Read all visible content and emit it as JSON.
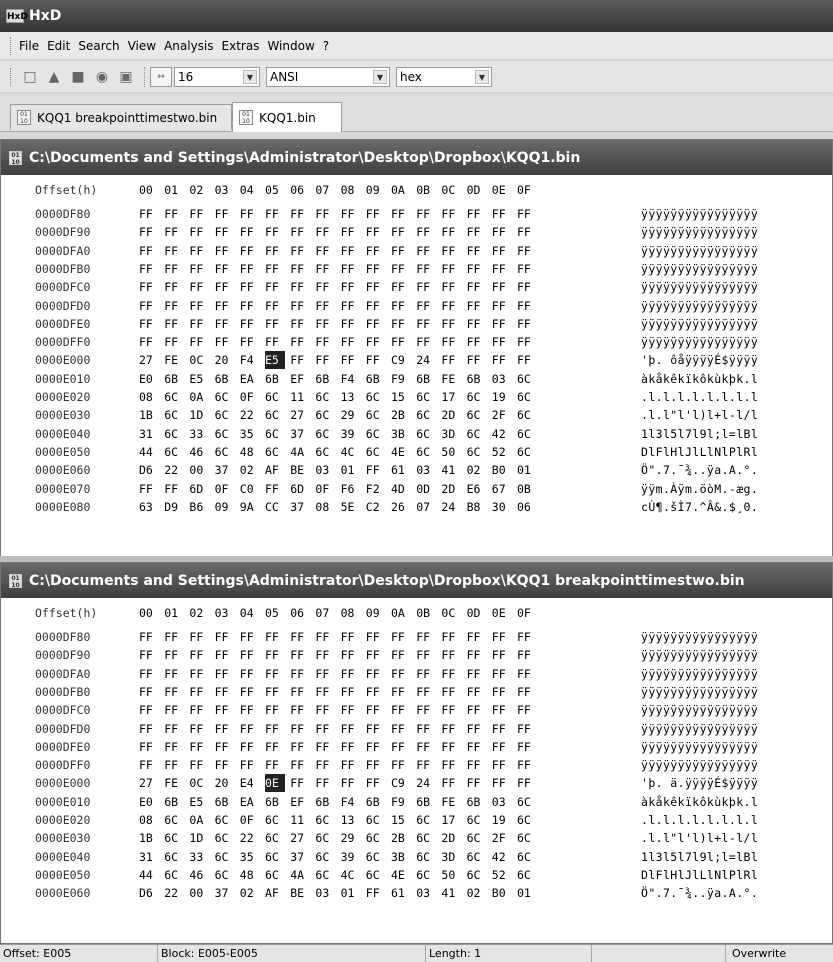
{
  "window": {
    "title": "HxD"
  },
  "menu": [
    "File",
    "Edit",
    "Search",
    "View",
    "Analysis",
    "Extras",
    "Window",
    "?"
  ],
  "toolbar": {
    "bytes_per_row": "16",
    "charset": "ANSI",
    "display_mode": "hex"
  },
  "tabs": [
    {
      "label": "KQQ1 breakpointtimestwo.bin",
      "active": false
    },
    {
      "label": "KQQ1.bin",
      "active": true
    }
  ],
  "editors": [
    {
      "path": "C:\\Documents and Settings\\Administrator\\Desktop\\Dropbox\\KQQ1.bin",
      "selected_col": 5,
      "selected_row": 8,
      "rows": [
        {
          "offset": "0000DF80",
          "bytes": [
            "FF",
            "FF",
            "FF",
            "FF",
            "FF",
            "FF",
            "FF",
            "FF",
            "FF",
            "FF",
            "FF",
            "FF",
            "FF",
            "FF",
            "FF",
            "FF"
          ],
          "ascii": "ÿÿÿÿÿÿÿÿÿÿÿÿÿÿÿÿ"
        },
        {
          "offset": "0000DF90",
          "bytes": [
            "FF",
            "FF",
            "FF",
            "FF",
            "FF",
            "FF",
            "FF",
            "FF",
            "FF",
            "FF",
            "FF",
            "FF",
            "FF",
            "FF",
            "FF",
            "FF"
          ],
          "ascii": "ÿÿÿÿÿÿÿÿÿÿÿÿÿÿÿÿ"
        },
        {
          "offset": "0000DFA0",
          "bytes": [
            "FF",
            "FF",
            "FF",
            "FF",
            "FF",
            "FF",
            "FF",
            "FF",
            "FF",
            "FF",
            "FF",
            "FF",
            "FF",
            "FF",
            "FF",
            "FF"
          ],
          "ascii": "ÿÿÿÿÿÿÿÿÿÿÿÿÿÿÿÿ"
        },
        {
          "offset": "0000DFB0",
          "bytes": [
            "FF",
            "FF",
            "FF",
            "FF",
            "FF",
            "FF",
            "FF",
            "FF",
            "FF",
            "FF",
            "FF",
            "FF",
            "FF",
            "FF",
            "FF",
            "FF"
          ],
          "ascii": "ÿÿÿÿÿÿÿÿÿÿÿÿÿÿÿÿ"
        },
        {
          "offset": "0000DFC0",
          "bytes": [
            "FF",
            "FF",
            "FF",
            "FF",
            "FF",
            "FF",
            "FF",
            "FF",
            "FF",
            "FF",
            "FF",
            "FF",
            "FF",
            "FF",
            "FF",
            "FF"
          ],
          "ascii": "ÿÿÿÿÿÿÿÿÿÿÿÿÿÿÿÿ"
        },
        {
          "offset": "0000DFD0",
          "bytes": [
            "FF",
            "FF",
            "FF",
            "FF",
            "FF",
            "FF",
            "FF",
            "FF",
            "FF",
            "FF",
            "FF",
            "FF",
            "FF",
            "FF",
            "FF",
            "FF"
          ],
          "ascii": "ÿÿÿÿÿÿÿÿÿÿÿÿÿÿÿÿ"
        },
        {
          "offset": "0000DFE0",
          "bytes": [
            "FF",
            "FF",
            "FF",
            "FF",
            "FF",
            "FF",
            "FF",
            "FF",
            "FF",
            "FF",
            "FF",
            "FF",
            "FF",
            "FF",
            "FF",
            "FF"
          ],
          "ascii": "ÿÿÿÿÿÿÿÿÿÿÿÿÿÿÿÿ"
        },
        {
          "offset": "0000DFF0",
          "bytes": [
            "FF",
            "FF",
            "FF",
            "FF",
            "FF",
            "FF",
            "FF",
            "FF",
            "FF",
            "FF",
            "FF",
            "FF",
            "FF",
            "FF",
            "FF",
            "FF"
          ],
          "ascii": "ÿÿÿÿÿÿÿÿÿÿÿÿÿÿÿÿ"
        },
        {
          "offset": "0000E000",
          "bytes": [
            "27",
            "FE",
            "0C",
            "20",
            "F4",
            "E5",
            "FF",
            "FF",
            "FF",
            "FF",
            "C9",
            "24",
            "FF",
            "FF",
            "FF",
            "FF"
          ],
          "ascii": "'þ. ôåÿÿÿÿÉ$ÿÿÿÿ"
        },
        {
          "offset": "0000E010",
          "bytes": [
            "E0",
            "6B",
            "E5",
            "6B",
            "EA",
            "6B",
            "EF",
            "6B",
            "F4",
            "6B",
            "F9",
            "6B",
            "FE",
            "6B",
            "03",
            "6C"
          ],
          "ascii": "àkåkêkïkôkùkþk.l"
        },
        {
          "offset": "0000E020",
          "bytes": [
            "08",
            "6C",
            "0A",
            "6C",
            "0F",
            "6C",
            "11",
            "6C",
            "13",
            "6C",
            "15",
            "6C",
            "17",
            "6C",
            "19",
            "6C"
          ],
          "ascii": ".l.l.l.l.l.l.l.l"
        },
        {
          "offset": "0000E030",
          "bytes": [
            "1B",
            "6C",
            "1D",
            "6C",
            "22",
            "6C",
            "27",
            "6C",
            "29",
            "6C",
            "2B",
            "6C",
            "2D",
            "6C",
            "2F",
            "6C"
          ],
          "ascii": ".l.l\"l'l)l+l-l/l"
        },
        {
          "offset": "0000E040",
          "bytes": [
            "31",
            "6C",
            "33",
            "6C",
            "35",
            "6C",
            "37",
            "6C",
            "39",
            "6C",
            "3B",
            "6C",
            "3D",
            "6C",
            "42",
            "6C"
          ],
          "ascii": "1l3l5l7l9l;l=lBl"
        },
        {
          "offset": "0000E050",
          "bytes": [
            "44",
            "6C",
            "46",
            "6C",
            "48",
            "6C",
            "4A",
            "6C",
            "4C",
            "6C",
            "4E",
            "6C",
            "50",
            "6C",
            "52",
            "6C"
          ],
          "ascii": "DlFlHlJlLlNlPlRl"
        },
        {
          "offset": "0000E060",
          "bytes": [
            "D6",
            "22",
            "00",
            "37",
            "02",
            "AF",
            "BE",
            "03",
            "01",
            "FF",
            "61",
            "03",
            "41",
            "02",
            "B0",
            "01"
          ],
          "ascii": "Ö\".7.¯¾..ÿa.A.°."
        },
        {
          "offset": "0000E070",
          "bytes": [
            "FF",
            "FF",
            "6D",
            "0F",
            "C0",
            "FF",
            "6D",
            "0F",
            "F6",
            "F2",
            "4D",
            "0D",
            "2D",
            "E6",
            "67",
            "0B"
          ],
          "ascii": "ÿÿm.Àÿm.öòM.-æg."
        },
        {
          "offset": "0000E080",
          "bytes": [
            "63",
            "D9",
            "B6",
            "09",
            "9A",
            "CC",
            "37",
            "08",
            "5E",
            "C2",
            "26",
            "07",
            "24",
            "B8",
            "30",
            "06"
          ],
          "ascii": "cÙ¶.šÌ7.^Â&.$¸0."
        }
      ]
    },
    {
      "path": "C:\\Documents and Settings\\Administrator\\Desktop\\Dropbox\\KQQ1 breakpointtimestwo.bin",
      "selected_col": 5,
      "selected_row": 8,
      "rows": [
        {
          "offset": "0000DF80",
          "bytes": [
            "FF",
            "FF",
            "FF",
            "FF",
            "FF",
            "FF",
            "FF",
            "FF",
            "FF",
            "FF",
            "FF",
            "FF",
            "FF",
            "FF",
            "FF",
            "FF"
          ],
          "ascii": "ÿÿÿÿÿÿÿÿÿÿÿÿÿÿÿÿ"
        },
        {
          "offset": "0000DF90",
          "bytes": [
            "FF",
            "FF",
            "FF",
            "FF",
            "FF",
            "FF",
            "FF",
            "FF",
            "FF",
            "FF",
            "FF",
            "FF",
            "FF",
            "FF",
            "FF",
            "FF"
          ],
          "ascii": "ÿÿÿÿÿÿÿÿÿÿÿÿÿÿÿÿ"
        },
        {
          "offset": "0000DFA0",
          "bytes": [
            "FF",
            "FF",
            "FF",
            "FF",
            "FF",
            "FF",
            "FF",
            "FF",
            "FF",
            "FF",
            "FF",
            "FF",
            "FF",
            "FF",
            "FF",
            "FF"
          ],
          "ascii": "ÿÿÿÿÿÿÿÿÿÿÿÿÿÿÿÿ"
        },
        {
          "offset": "0000DFB0",
          "bytes": [
            "FF",
            "FF",
            "FF",
            "FF",
            "FF",
            "FF",
            "FF",
            "FF",
            "FF",
            "FF",
            "FF",
            "FF",
            "FF",
            "FF",
            "FF",
            "FF"
          ],
          "ascii": "ÿÿÿÿÿÿÿÿÿÿÿÿÿÿÿÿ"
        },
        {
          "offset": "0000DFC0",
          "bytes": [
            "FF",
            "FF",
            "FF",
            "FF",
            "FF",
            "FF",
            "FF",
            "FF",
            "FF",
            "FF",
            "FF",
            "FF",
            "FF",
            "FF",
            "FF",
            "FF"
          ],
          "ascii": "ÿÿÿÿÿÿÿÿÿÿÿÿÿÿÿÿ"
        },
        {
          "offset": "0000DFD0",
          "bytes": [
            "FF",
            "FF",
            "FF",
            "FF",
            "FF",
            "FF",
            "FF",
            "FF",
            "FF",
            "FF",
            "FF",
            "FF",
            "FF",
            "FF",
            "FF",
            "FF"
          ],
          "ascii": "ÿÿÿÿÿÿÿÿÿÿÿÿÿÿÿÿ"
        },
        {
          "offset": "0000DFE0",
          "bytes": [
            "FF",
            "FF",
            "FF",
            "FF",
            "FF",
            "FF",
            "FF",
            "FF",
            "FF",
            "FF",
            "FF",
            "FF",
            "FF",
            "FF",
            "FF",
            "FF"
          ],
          "ascii": "ÿÿÿÿÿÿÿÿÿÿÿÿÿÿÿÿ"
        },
        {
          "offset": "0000DFF0",
          "bytes": [
            "FF",
            "FF",
            "FF",
            "FF",
            "FF",
            "FF",
            "FF",
            "FF",
            "FF",
            "FF",
            "FF",
            "FF",
            "FF",
            "FF",
            "FF",
            "FF"
          ],
          "ascii": "ÿÿÿÿÿÿÿÿÿÿÿÿÿÿÿÿ"
        },
        {
          "offset": "0000E000",
          "bytes": [
            "27",
            "FE",
            "0C",
            "20",
            "E4",
            "0E",
            "FF",
            "FF",
            "FF",
            "FF",
            "C9",
            "24",
            "FF",
            "FF",
            "FF",
            "FF"
          ],
          "ascii": "'þ. ä.ÿÿÿÿÉ$ÿÿÿÿ"
        },
        {
          "offset": "0000E010",
          "bytes": [
            "E0",
            "6B",
            "E5",
            "6B",
            "EA",
            "6B",
            "EF",
            "6B",
            "F4",
            "6B",
            "F9",
            "6B",
            "FE",
            "6B",
            "03",
            "6C"
          ],
          "ascii": "àkåkêkïkôkùkþk.l"
        },
        {
          "offset": "0000E020",
          "bytes": [
            "08",
            "6C",
            "0A",
            "6C",
            "0F",
            "6C",
            "11",
            "6C",
            "13",
            "6C",
            "15",
            "6C",
            "17",
            "6C",
            "19",
            "6C"
          ],
          "ascii": ".l.l.l.l.l.l.l.l"
        },
        {
          "offset": "0000E030",
          "bytes": [
            "1B",
            "6C",
            "1D",
            "6C",
            "22",
            "6C",
            "27",
            "6C",
            "29",
            "6C",
            "2B",
            "6C",
            "2D",
            "6C",
            "2F",
            "6C"
          ],
          "ascii": ".l.l\"l'l)l+l-l/l"
        },
        {
          "offset": "0000E040",
          "bytes": [
            "31",
            "6C",
            "33",
            "6C",
            "35",
            "6C",
            "37",
            "6C",
            "39",
            "6C",
            "3B",
            "6C",
            "3D",
            "6C",
            "42",
            "6C"
          ],
          "ascii": "1l3l5l7l9l;l=lBl"
        },
        {
          "offset": "0000E050",
          "bytes": [
            "44",
            "6C",
            "46",
            "6C",
            "48",
            "6C",
            "4A",
            "6C",
            "4C",
            "6C",
            "4E",
            "6C",
            "50",
            "6C",
            "52",
            "6C"
          ],
          "ascii": "DlFlHlJlLlNlPlRl"
        },
        {
          "offset": "0000E060",
          "bytes": [
            "D6",
            "22",
            "00",
            "37",
            "02",
            "AF",
            "BE",
            "03",
            "01",
            "FF",
            "61",
            "03",
            "41",
            "02",
            "B0",
            "01"
          ],
          "ascii": "Ö\".7.¯¾..ÿa.A.°."
        }
      ]
    }
  ],
  "column_header": {
    "label": "Offset(h)",
    "cols": [
      "00",
      "01",
      "02",
      "03",
      "04",
      "05",
      "06",
      "07",
      "08",
      "09",
      "0A",
      "0B",
      "0C",
      "0D",
      "0E",
      "0F"
    ]
  },
  "status": {
    "offset": "Offset: E005",
    "block": "Block: E005-E005",
    "length": "Length: 1",
    "mode": "Overwrite"
  }
}
